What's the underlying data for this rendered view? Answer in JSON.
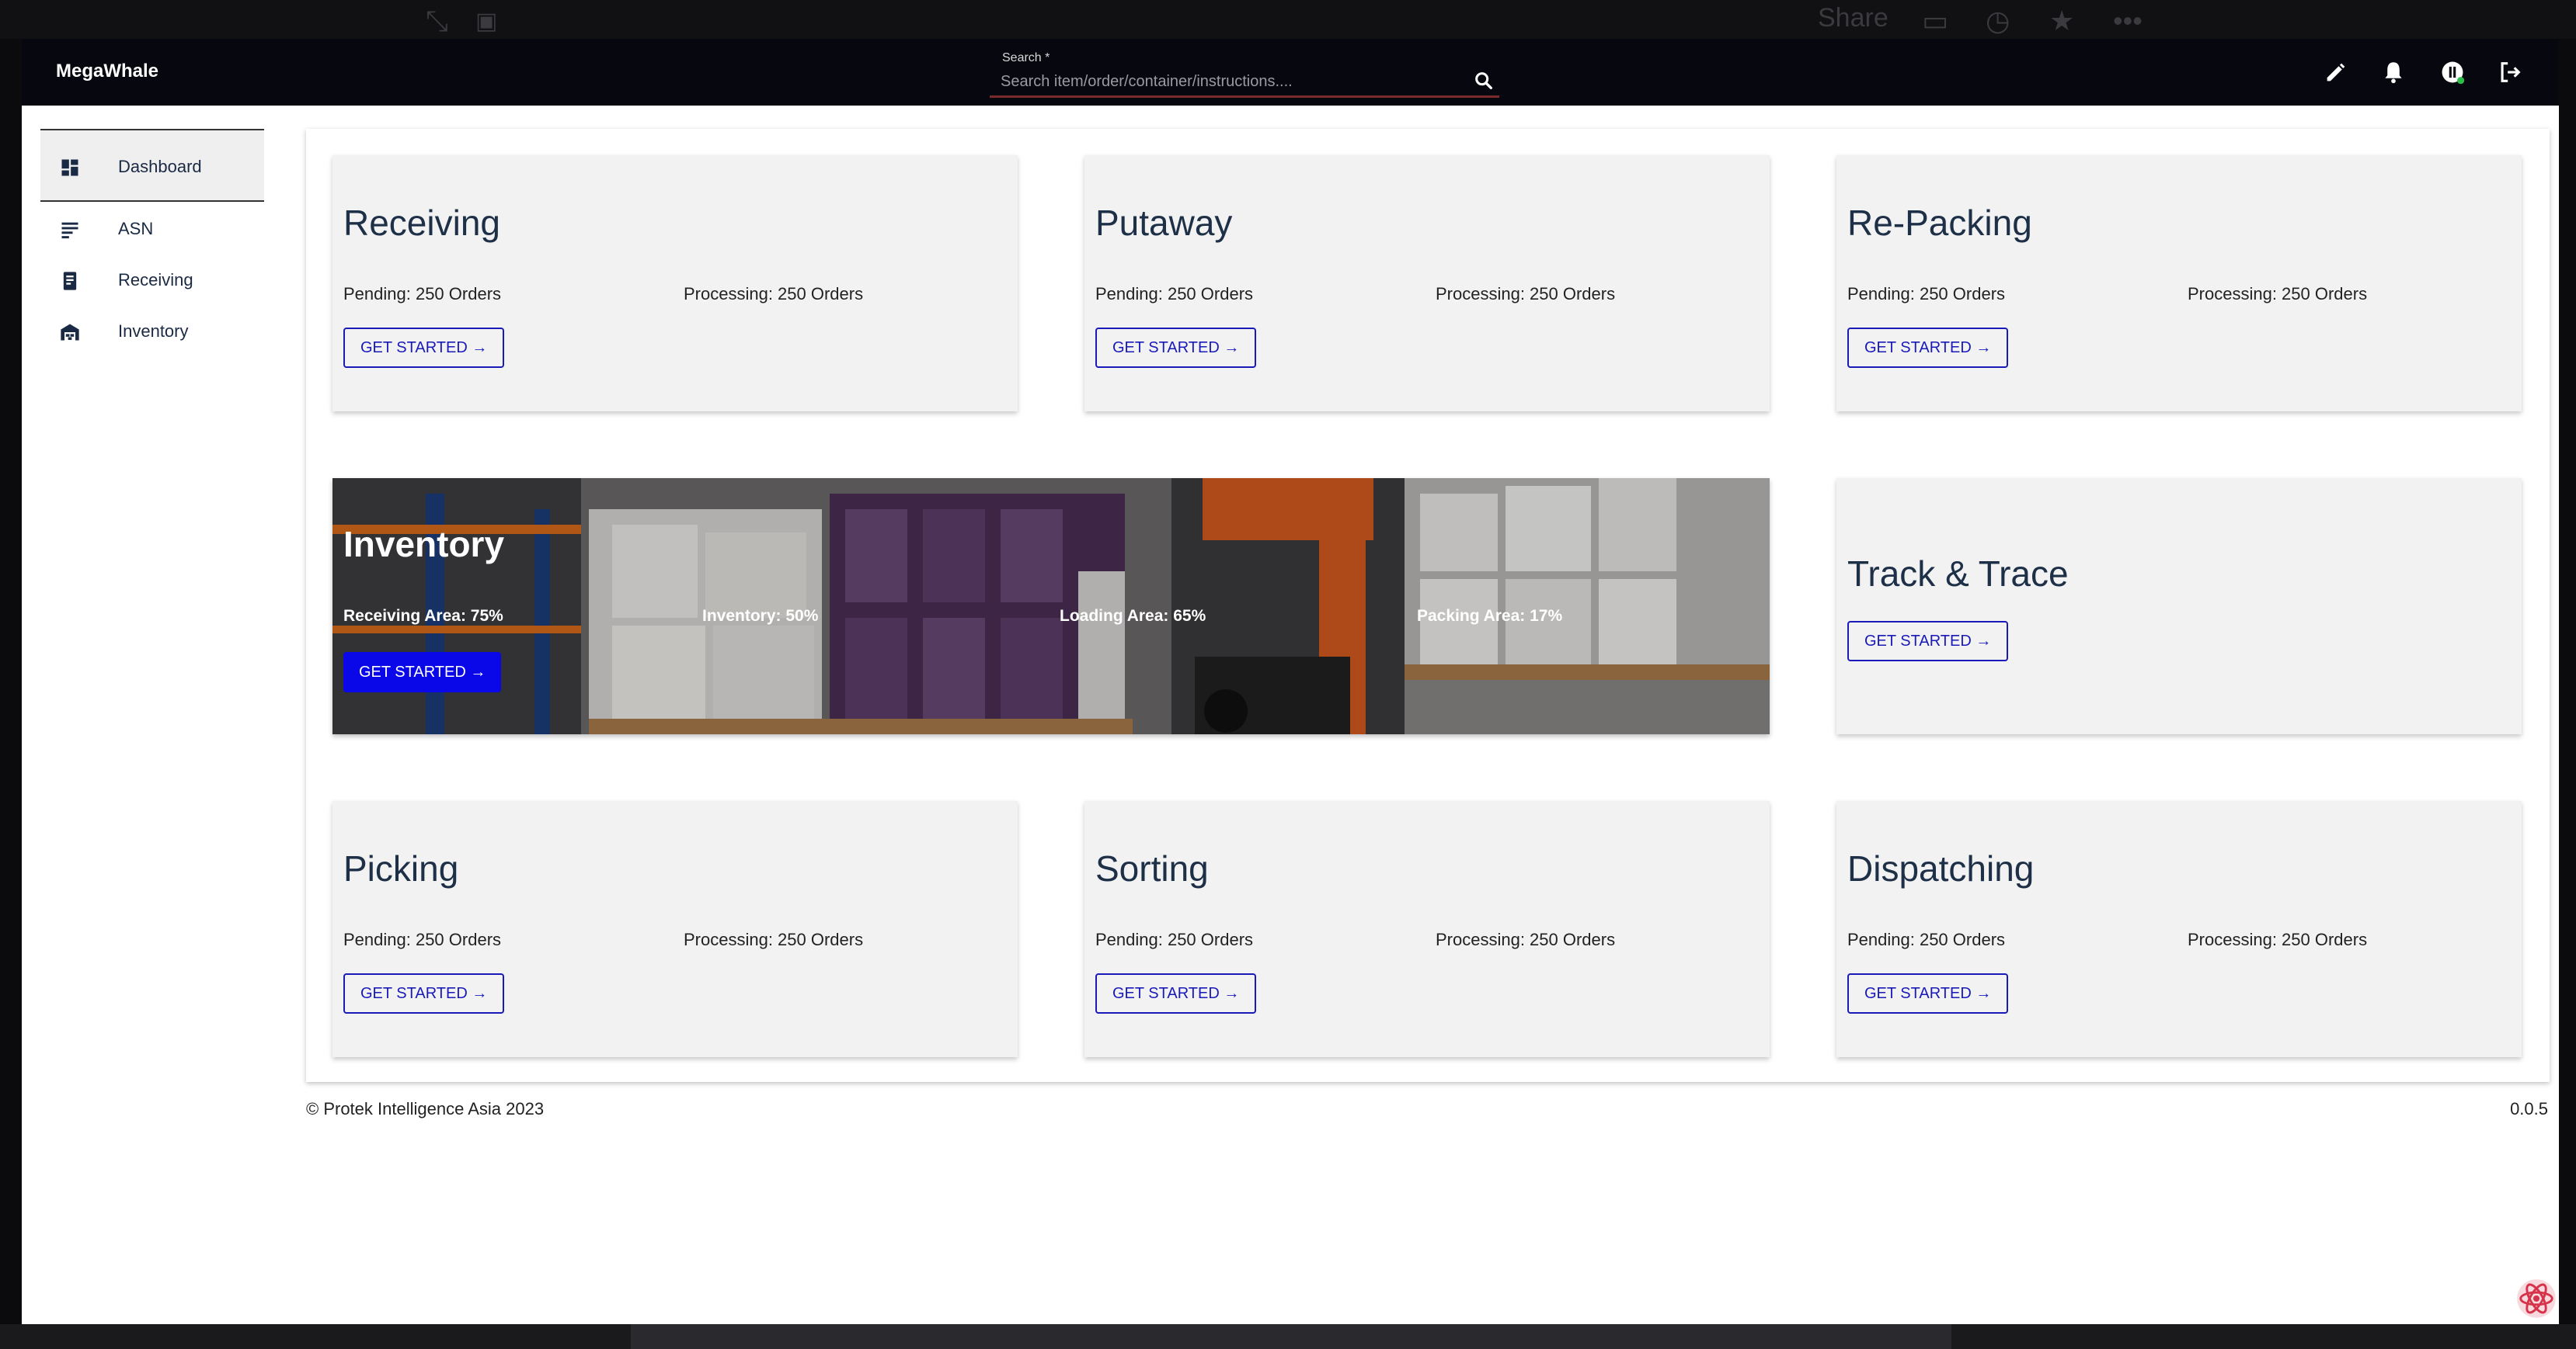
{
  "browser_chrome": {
    "share_label": "Share"
  },
  "appbar": {
    "brand": "MegaWhale",
    "search_label": "Search *",
    "search_placeholder": "Search item/order/container/instructions....",
    "search_value": ""
  },
  "sidebar": {
    "items": [
      {
        "label": "Dashboard",
        "icon": "dashboard-icon",
        "active": true
      },
      {
        "label": "ASN",
        "icon": "list-icon"
      },
      {
        "label": "Receiving",
        "icon": "receipt-icon"
      },
      {
        "label": "Inventory",
        "icon": "warehouse-icon"
      }
    ]
  },
  "cards": {
    "receiving": {
      "title": "Receiving",
      "pending": "Pending: 250 Orders",
      "processing": "Processing: 250 Orders",
      "button": "GET STARTED →"
    },
    "putaway": {
      "title": "Putaway",
      "pending": "Pending: 250 Orders",
      "processing": "Processing: 250 Orders",
      "button": "GET STARTED →"
    },
    "repacking": {
      "title": "Re-Packing",
      "pending": "Pending: 250 Orders",
      "processing": "Processing: 250 Orders",
      "button": "GET STARTED →"
    },
    "inventory": {
      "title": "Inventory",
      "stats": [
        "Receiving Area: 75%",
        "Inventory: 50%",
        "Loading Area: 65%",
        "Packing Area: 17%"
      ],
      "button": "GET STARTED →"
    },
    "track": {
      "title": "Track & Trace",
      "button": "GET STARTED →"
    },
    "picking": {
      "title": "Picking",
      "pending": "Pending: 250 Orders",
      "processing": "Processing: 250 Orders",
      "button": "GET STARTED →"
    },
    "sorting": {
      "title": "Sorting",
      "pending": "Pending: 250 Orders",
      "processing": "Processing: 250 Orders",
      "button": "GET STARTED →"
    },
    "dispatching": {
      "title": "Dispatching",
      "pending": "Pending: 250 Orders",
      "processing": "Processing: 250 Orders",
      "button": "GET STARTED →"
    }
  },
  "footer": {
    "copyright": "© Protek Intelligence Asia 2023",
    "version": "0.0.5"
  },
  "colors": {
    "appbar": "#07080f",
    "accent": "#1a1ab8",
    "primary_button": "#0a08e8",
    "card_bg": "#f2f2f2",
    "title": "#1e3047"
  }
}
